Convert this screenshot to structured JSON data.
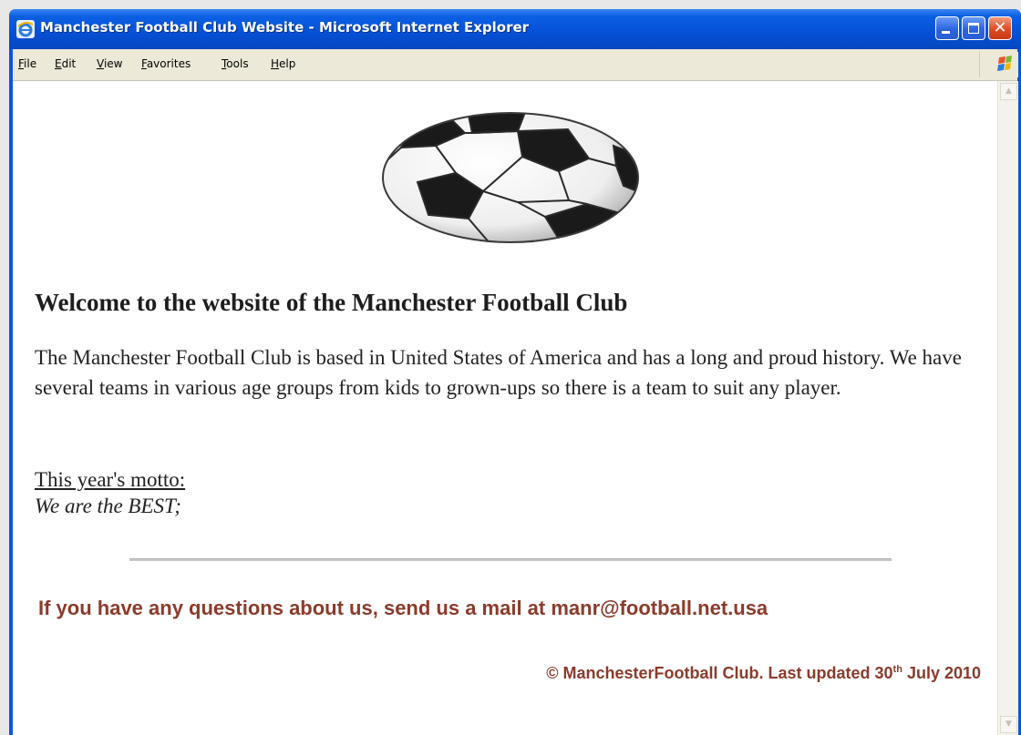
{
  "window": {
    "title": "Manchester Football Club Website - Microsoft Internet Explorer",
    "title_icon": "ie-icon",
    "controls": {
      "minimize_icon": "minimize-icon",
      "maximize_icon": "maximize-icon",
      "close_icon": "close-icon",
      "close_glyph": "✕"
    }
  },
  "menubar": {
    "items": [
      "File",
      "Edit",
      "View",
      "Favorites",
      "Tools",
      "Help"
    ],
    "throbber_icon": "windows-flag-icon"
  },
  "page": {
    "logo_icon": "soccer-ball-icon",
    "heading": "Welcome to the website of the Manchester Football Club",
    "intro": "The Manchester Football Club is based in United States of America and has a long and proud history. We have several teams in various age groups from kids to grown-ups so there is a team to suit any player.",
    "motto_label": "This year's motto:",
    "motto": "We are the BEST;",
    "contact": "If you have any questions about us, send us a mail at manr@football.net.usa",
    "footer": {
      "copyright_symbol": "©",
      "text": "ManchesterFootball Club. Last updated 30",
      "date_suffix": "th",
      "date_rest": " July 2010"
    }
  },
  "colors": {
    "titlebar": "#0550d6",
    "menubar": "#ece9d8",
    "accent_text": "#8b3b2b"
  }
}
